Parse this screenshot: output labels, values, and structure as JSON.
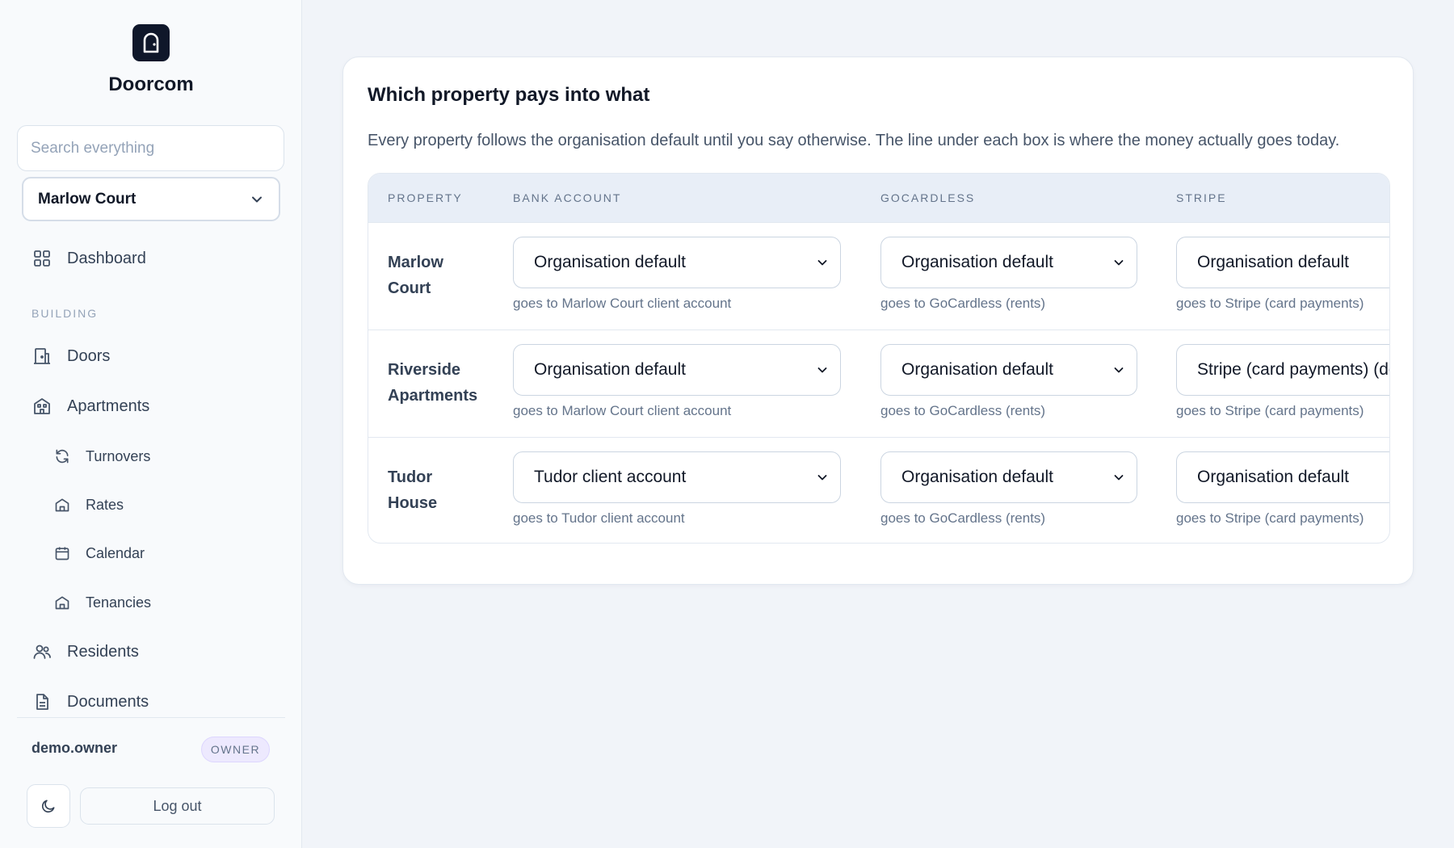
{
  "app": {
    "brand": "Doorcom"
  },
  "sidebar": {
    "search_placeholder": "Search everything",
    "property_selector": "Marlow Court",
    "dashboard": "Dashboard",
    "section_building": "BUILDING",
    "doors": "Doors",
    "apartments": "Apartments",
    "turnovers": "Turnovers",
    "rates": "Rates",
    "calendar": "Calendar",
    "tenancies": "Tenancies",
    "residents": "Residents",
    "documents": "Documents",
    "user_name": "demo.owner",
    "role": "OWNER",
    "logout": "Log out"
  },
  "main": {
    "title": "Which property pays into what",
    "description": "Every property follows the organisation default until you say otherwise. The line under each box is where the money actually goes today.",
    "columns": {
      "property": "PROPERTY",
      "bank": "BANK ACCOUNT",
      "gocardless": "GOCARDLESS",
      "stripe": "STRIPE"
    },
    "rows": [
      {
        "property_line1": "Marlow",
        "property_line2": "Court",
        "bank_value": "Organisation default",
        "bank_hint": "goes to Marlow Court client account",
        "gc_value": "Organisation default",
        "gc_hint": "goes to GoCardless (rents)",
        "stripe_value": "Organisation default",
        "stripe_hint": "goes to Stripe (card payments)"
      },
      {
        "property_line1": "Riverside",
        "property_line2": "Apartments",
        "bank_value": "Organisation default",
        "bank_hint": "goes to Marlow Court client account",
        "gc_value": "Organisation default",
        "gc_hint": "goes to GoCardless (rents)",
        "stripe_value": "Stripe (card payments) (de",
        "stripe_hint": "goes to Stripe (card payments)"
      },
      {
        "property_line1": "Tudor",
        "property_line2": "House",
        "bank_value": "Tudor client account",
        "bank_hint": "goes to Tudor client account",
        "gc_value": "Organisation default",
        "gc_hint": "goes to GoCardless (rents)",
        "stripe_value": "Organisation default",
        "stripe_hint": "goes to Stripe (card payments)"
      }
    ]
  },
  "icons": {
    "logo": "door-icon",
    "dashboard": "grid-icon",
    "doors": "door-building-icon",
    "apartments": "building-icon",
    "turnovers": "refresh-icon",
    "rates": "house-icon",
    "calendar": "calendar-icon",
    "tenancies": "house-icon",
    "residents": "users-icon",
    "documents": "document-icon",
    "theme": "moon-icon",
    "select": "chevron-down-icon"
  },
  "colors": {
    "sidebar_bg": "#f8fafc",
    "page_bg": "#f1f4f9",
    "table_header_bg": "#e8eef7",
    "role_badge_bg": "#ede9fe",
    "text_dark": "#111827"
  }
}
